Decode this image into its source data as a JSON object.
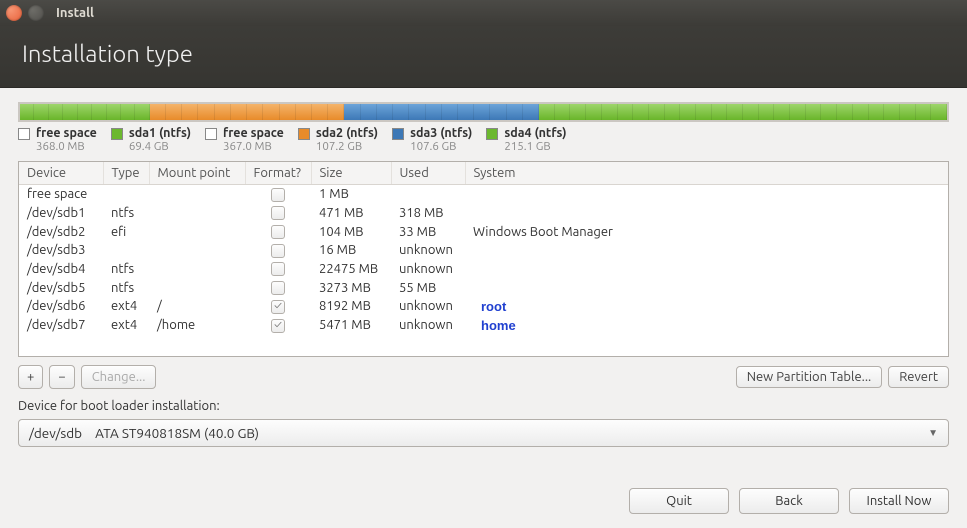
{
  "window": {
    "title": "Install"
  },
  "header": {
    "title": "Installation type"
  },
  "bar_segments": [
    {
      "color": "green",
      "width_pct": 14,
      "ticks": 9
    },
    {
      "color": "orange",
      "width_pct": 21,
      "ticks": 12
    },
    {
      "color": "blue",
      "width_pct": 21,
      "ticks": 12
    },
    {
      "color": "green",
      "width_pct": 44,
      "ticks": 26
    }
  ],
  "legend": [
    {
      "swatch": "white",
      "label": "free space",
      "sub": "368.0 MB"
    },
    {
      "swatch": "green",
      "label": "sda1 (ntfs)",
      "sub": "69.4 GB"
    },
    {
      "swatch": "white",
      "label": "free space",
      "sub": "367.0 MB"
    },
    {
      "swatch": "orange",
      "label": "sda2 (ntfs)",
      "sub": "107.2 GB"
    },
    {
      "swatch": "blue",
      "label": "sda3 (ntfs)",
      "sub": "107.6 GB"
    },
    {
      "swatch": "green",
      "label": "sda4 (ntfs)",
      "sub": "215.1 GB"
    }
  ],
  "table": {
    "columns": [
      "Device",
      "Type",
      "Mount point",
      "Format?",
      "Size",
      "Used",
      "System"
    ],
    "rows": [
      {
        "device": "free space",
        "type": "",
        "mount": "",
        "format": false,
        "size": "1 MB",
        "used": "",
        "system": "",
        "annot": ""
      },
      {
        "device": "/dev/sdb1",
        "type": "ntfs",
        "mount": "",
        "format": false,
        "size": "471 MB",
        "used": "318 MB",
        "system": "",
        "annot": ""
      },
      {
        "device": "/dev/sdb2",
        "type": "efi",
        "mount": "",
        "format": false,
        "size": "104 MB",
        "used": "33 MB",
        "system": "Windows Boot Manager",
        "annot": ""
      },
      {
        "device": "/dev/sdb3",
        "type": "",
        "mount": "",
        "format": false,
        "size": "16 MB",
        "used": "unknown",
        "system": "",
        "annot": ""
      },
      {
        "device": "/dev/sdb4",
        "type": "ntfs",
        "mount": "",
        "format": false,
        "size": "22475 MB",
        "used": "unknown",
        "system": "",
        "annot": ""
      },
      {
        "device": "/dev/sdb5",
        "type": "ntfs",
        "mount": "",
        "format": false,
        "size": "3273 MB",
        "used": "55 MB",
        "system": "",
        "annot": ""
      },
      {
        "device": "/dev/sdb6",
        "type": "ext4",
        "mount": "/",
        "format": true,
        "size": "8192 MB",
        "used": "unknown",
        "system": "",
        "annot": "root"
      },
      {
        "device": "/dev/sdb7",
        "type": "ext4",
        "mount": "/home",
        "format": true,
        "size": "5471 MB",
        "used": "unknown",
        "system": "",
        "annot": "home"
      }
    ]
  },
  "toolbar": {
    "plus": "+",
    "minus": "−",
    "change": "Change...",
    "new_table": "New Partition Table...",
    "revert": "Revert"
  },
  "bootloader": {
    "label": "Device for boot loader installation:",
    "device": "/dev/sdb",
    "desc": "ATA ST940818SM (40.0 GB)"
  },
  "footer": {
    "quit": "Quit",
    "back": "Back",
    "install": "Install Now"
  }
}
